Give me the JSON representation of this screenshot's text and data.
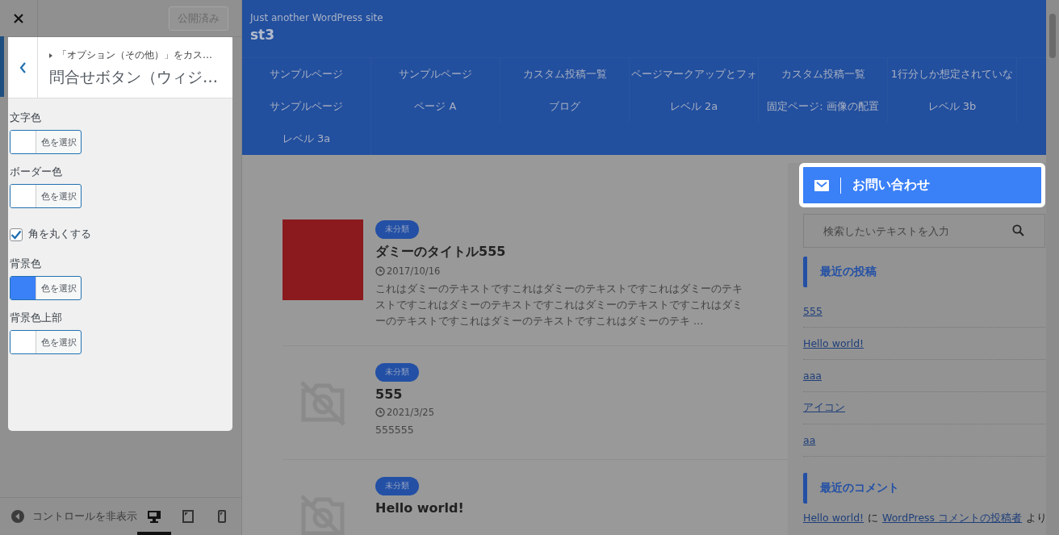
{
  "customizer": {
    "publish_button": "公開済み",
    "panel": {
      "breadcrumb": "「オプション（その他）」をカス…",
      "title": "問合せボタン（ウィジ…",
      "controls": [
        {
          "kind": "color",
          "label": "文字色",
          "button": "色を選択"
        },
        {
          "kind": "color",
          "label": "ボーダー色",
          "button": "色を選択"
        },
        {
          "kind": "checkbox",
          "label": "角を丸くする",
          "checked": true
        },
        {
          "kind": "color",
          "label": "背景色",
          "button": "色を選択",
          "color": "#3a80f7"
        },
        {
          "kind": "color",
          "label": "背景色上部",
          "button": "色を選択"
        }
      ]
    },
    "footer": {
      "hide_controls": "コントロールを非表示",
      "devices": [
        {
          "kind": "desktop",
          "selected": true
        },
        {
          "kind": "tablet",
          "selected": false
        },
        {
          "kind": "mobile",
          "selected": false
        }
      ]
    }
  },
  "site": {
    "tagline": "Just another WordPress site",
    "title": "st3",
    "nav": [
      "サンプルページ",
      "サンプルページ",
      "カスタム投稿一覧",
      "ページマークアップとフォ",
      "カスタム投稿一覧",
      "1行分しか想定されていな",
      "サンプルページ",
      "ページ A",
      "ブログ",
      "レベル 2a",
      "固定ページ: 画像の配置",
      "レベル 3b",
      "レベル 3a"
    ],
    "posts": [
      {
        "kind": "photo",
        "category": "未分類",
        "title": "ダミーのタイトル555",
        "date": "2017/10/16",
        "excerpt": "これはダミーのテキストですこれはダミーのテキストですこれはダミーのテキストですこれはダミーのテキストですこれはダミーのテキストですこれはダミーのテキストですこれはダミーのテキストですこれはダミーのテキ …"
      },
      {
        "kind": "no_image",
        "category": "未分類",
        "title": "555",
        "date": "2021/3/25",
        "excerpt": "555555"
      },
      {
        "kind": "no_image",
        "category": "未分類",
        "title": "Hello world!"
      }
    ],
    "contact_button": "お問い合わせ",
    "search": {
      "placeholder": "検索したいテキストを入力"
    },
    "recent_posts": {
      "heading": "最近の投稿",
      "links": [
        "555",
        "Hello world!",
        "aaa",
        "アイコン",
        "aa"
      ]
    },
    "recent_comments": {
      "heading": "最近のコメント",
      "comment": {
        "post": "Hello world!",
        "joiner": "に",
        "author": "WordPress コメントの投稿者",
        "suffix": "より"
      }
    }
  }
}
